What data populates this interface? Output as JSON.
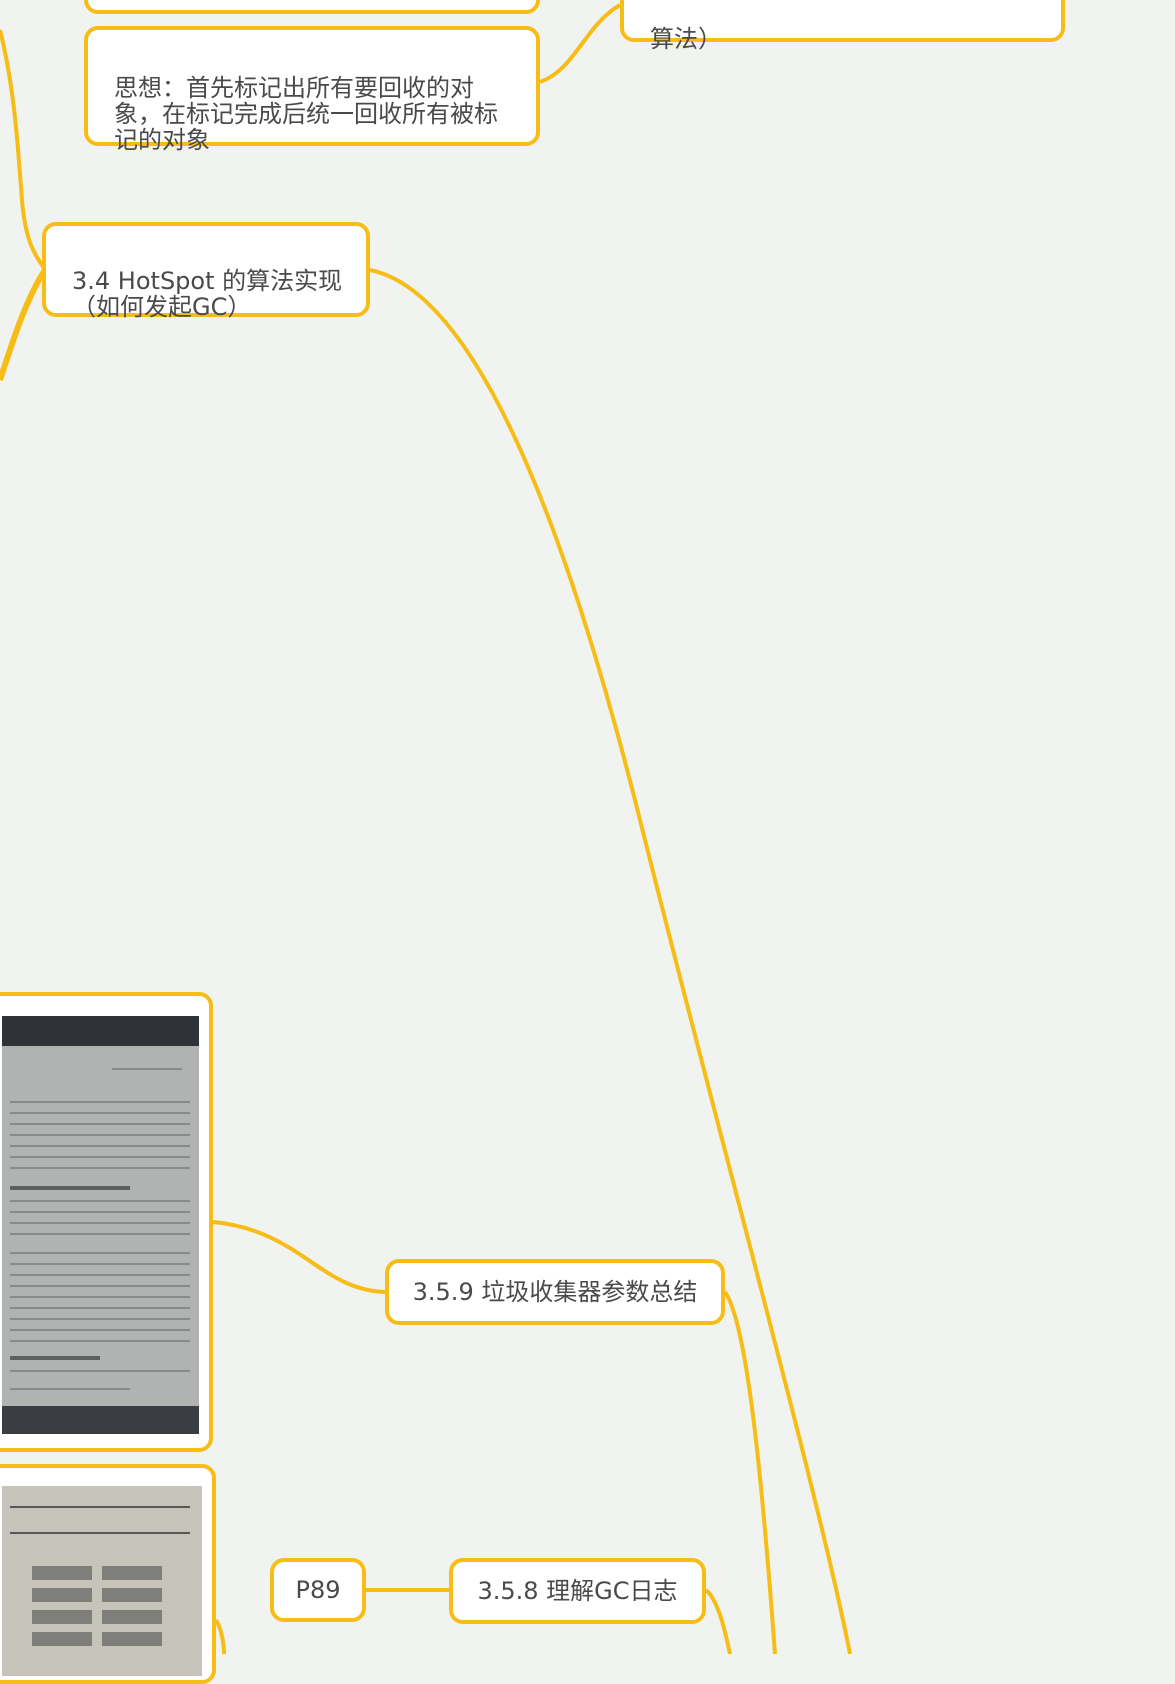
{
  "colors": {
    "background": "#f1f3f0",
    "branch": "#f7bd16",
    "node_fill": "#ffffff",
    "text": "#4a4a4a"
  },
  "nodes": {
    "mark_sweep_tail": "算法）",
    "mark_sweep_idea": "思想：首先标记出所有要回收的对\n象，在标记完成后统一回收所有被标\n记的对象",
    "hotspot_impl": "3.4 HotSpot 的算法实现\n（如何发起GC）",
    "gc_params_summary": "3.5.9 垃圾收集器参数总结",
    "gc_log": "3.5.8 理解GC日志",
    "page_ref": "P89"
  },
  "images": {
    "params_table_photo": "photo-of-book-page-icon",
    "g1_region_photo": "photo-of-book-page-icon"
  }
}
